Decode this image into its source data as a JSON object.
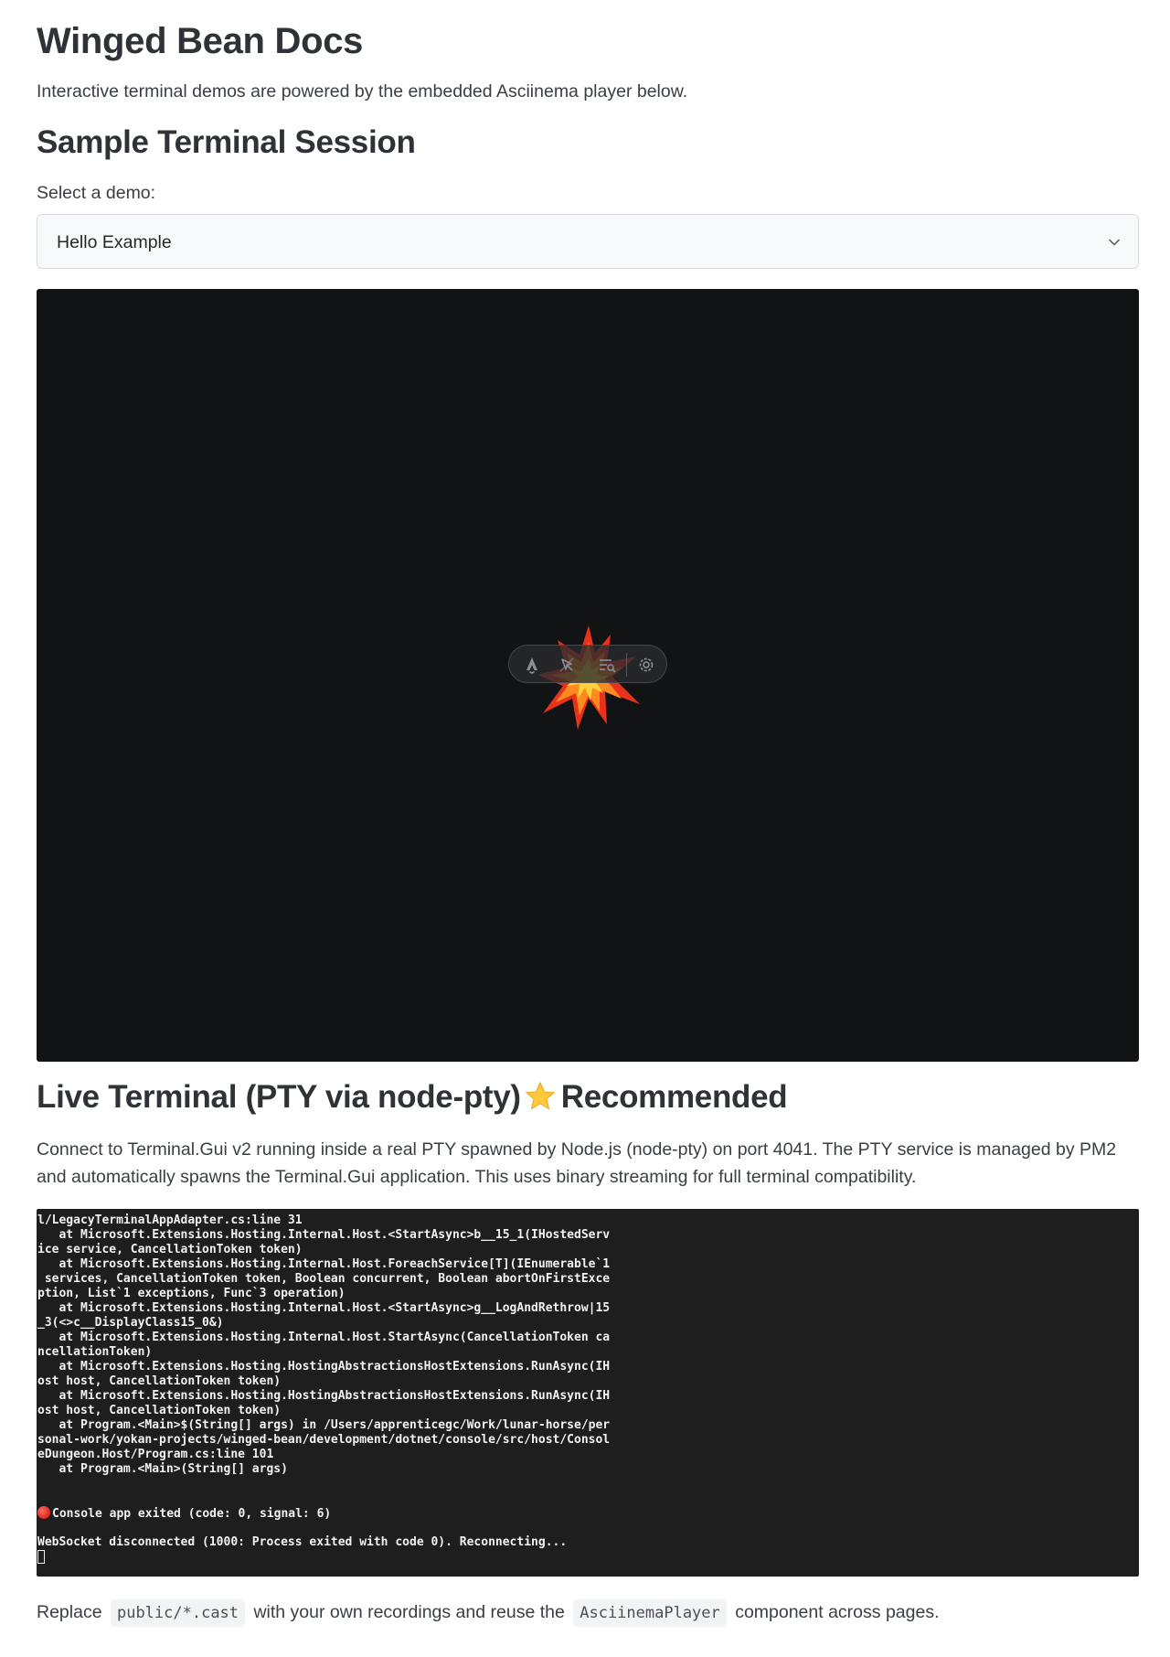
{
  "page": {
    "title": "Winged Bean Docs",
    "intro": "Interactive terminal demos are powered by the embedded Asciinema player below."
  },
  "sample": {
    "heading": "Sample Terminal Session",
    "select_label": "Select a demo:",
    "selected_demo": "Hello Example"
  },
  "player": {
    "background": "#121314",
    "toolbar_icons": [
      "astro-icon",
      "inspect-cursor-icon",
      "audit-list-icon",
      "settings-gear-icon"
    ],
    "overlay_icon": "explosion-burst-icon"
  },
  "live": {
    "heading_main": "Live Terminal (PTY via node-pty)",
    "heading_icon": "star-icon",
    "heading_badge": "Recommended",
    "description": "Connect to Terminal.Gui v2 running inside a real PTY spawned by Node.js (node-pty) on port 4041. The PTY service is managed by PM2 and automatically spawns the Terminal.Gui application. This uses binary streaming for full terminal compatibility."
  },
  "terminal": {
    "background": "#1e1e1e",
    "lines": [
      "l/LegacyTerminalAppAdapter.cs:line 31",
      "   at Microsoft.Extensions.Hosting.Internal.Host.<StartAsync>b__15_1(IHostedServ",
      "ice service, CancellationToken token)",
      "   at Microsoft.Extensions.Hosting.Internal.Host.ForeachService[T](IEnumerable`1",
      " services, CancellationToken token, Boolean concurrent, Boolean abortOnFirstExce",
      "ption, List`1 exceptions, Func`3 operation)",
      "   at Microsoft.Extensions.Hosting.Internal.Host.<StartAsync>g__LogAndRethrow|15",
      "_3(<>c__DisplayClass15_0&)",
      "   at Microsoft.Extensions.Hosting.Internal.Host.StartAsync(CancellationToken ca",
      "ncellationToken)",
      "   at Microsoft.Extensions.Hosting.HostingAbstractionsHostExtensions.RunAsync(IH",
      "ost host, CancellationToken token)",
      "   at Microsoft.Extensions.Hosting.HostingAbstractionsHostExtensions.RunAsync(IH",
      "ost host, CancellationToken token)",
      "   at Program.<Main>$(String[] args) in /Users/apprenticegc/Work/lunar-horse/per",
      "sonal-work/yokan-projects/winged-bean/development/dotnet/console/src/host/Consol",
      "eDungeon.Host/Program.cs:line 101",
      "   at Program.<Main>(String[] args)"
    ],
    "exit_line": "Console app exited (code: 0, signal: 6)",
    "ws_line": "WebSocket disconnected (1000: Process exited with code 0). Reconnecting..."
  },
  "footer": {
    "replace": "Replace",
    "code1": "public/*.cast",
    "middle": "with your own recordings and reuse the",
    "code2": "AsciinemaPlayer",
    "end": "component across pages."
  }
}
